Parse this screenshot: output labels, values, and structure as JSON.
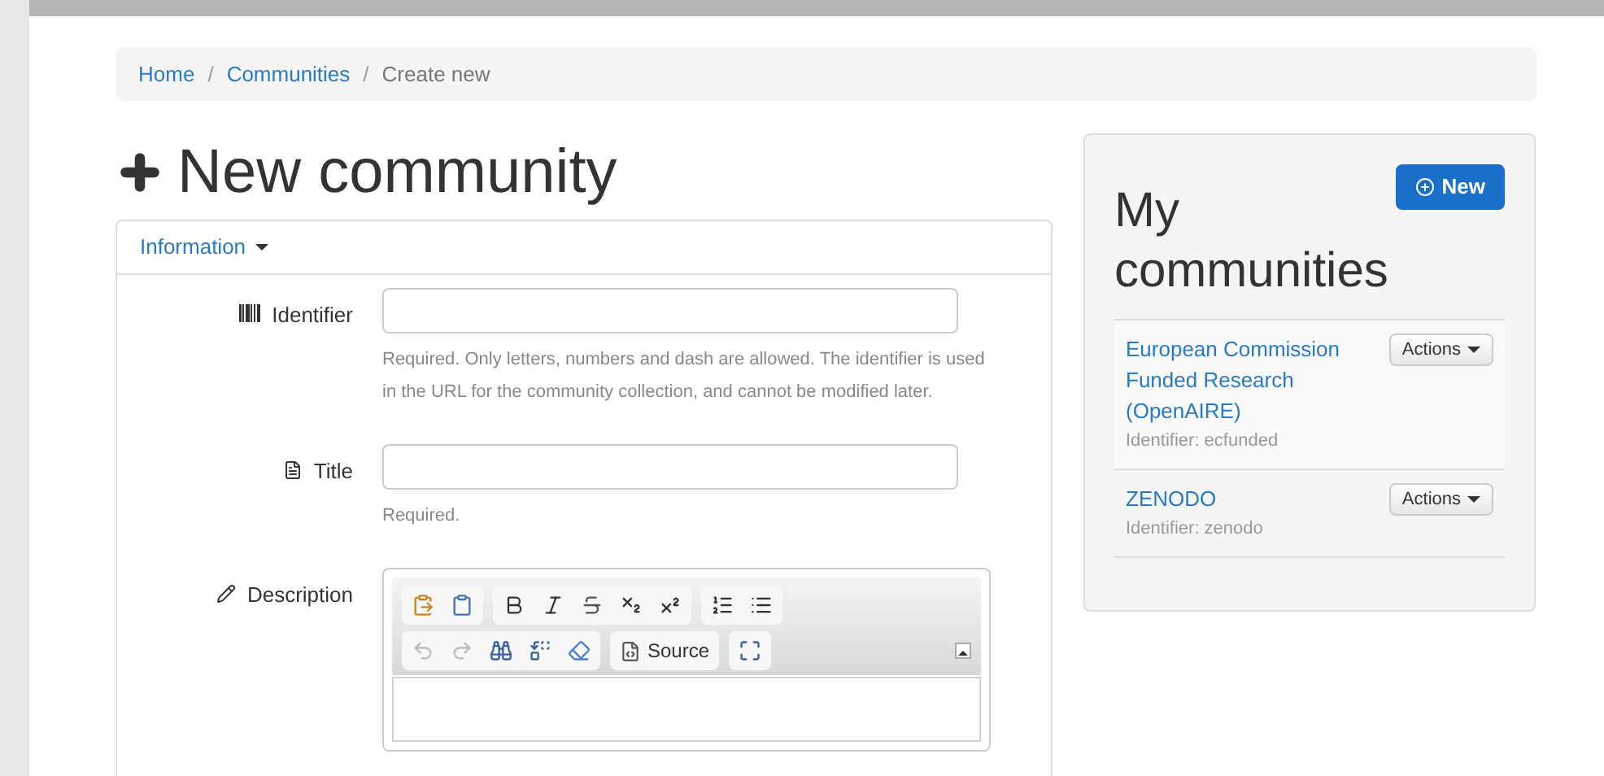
{
  "breadcrumb": [
    {
      "label": "Home",
      "kind": "link"
    },
    {
      "label": "/",
      "kind": "separator"
    },
    {
      "label": "Communities",
      "kind": "link"
    },
    {
      "label": "/",
      "kind": "separator"
    },
    {
      "label": "Create new",
      "kind": "current"
    }
  ],
  "page_title": "New community",
  "form": {
    "section_tab": "Information",
    "fields": [
      {
        "kind": "text",
        "label": "Identifier",
        "help": "Required. Only letters, numbers and dash are allowed. The identifier is used in the URL for the community collection, and cannot be modified later."
      },
      {
        "kind": "text",
        "label": "Title",
        "help": "Required."
      },
      {
        "kind": "editor",
        "label": "Description",
        "source_button": "Source"
      }
    ]
  },
  "sidebar": {
    "title": "My communities",
    "new_button": "New",
    "communities": [
      {
        "name": "European Commission Funded Research (OpenAIRE)",
        "identifier": "Identifier: ecfunded",
        "actions": "Actions"
      },
      {
        "name": "ZENODO",
        "identifier": "Identifier: zenodo",
        "actions": "Actions"
      }
    ]
  }
}
